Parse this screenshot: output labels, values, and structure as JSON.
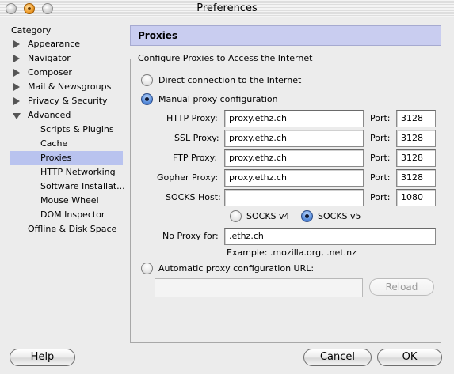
{
  "window": {
    "title": "Preferences"
  },
  "sidebar": {
    "header": "Category",
    "items": [
      {
        "label": "Appearance",
        "expander": "right"
      },
      {
        "label": "Navigator",
        "expander": "right"
      },
      {
        "label": "Composer",
        "expander": "right"
      },
      {
        "label": "Mail & Newsgroups",
        "expander": "right"
      },
      {
        "label": "Privacy & Security",
        "expander": "right"
      },
      {
        "label": "Advanced",
        "expander": "down"
      },
      {
        "label": "Scripts & Plugins"
      },
      {
        "label": "Cache"
      },
      {
        "label": "Proxies",
        "selected": true
      },
      {
        "label": "HTTP Networking"
      },
      {
        "label": "Software Installat..."
      },
      {
        "label": "Mouse Wheel"
      },
      {
        "label": "DOM Inspector"
      },
      {
        "label": "Offline & Disk Space"
      }
    ]
  },
  "panel": {
    "title": "Proxies",
    "group_label": "Configure Proxies to Access the Internet",
    "direct_label": "Direct connection to the Internet",
    "manual_label": "Manual proxy configuration",
    "selected_mode": "manual",
    "port_label": "Port:",
    "proxies": [
      {
        "label": "HTTP Proxy:",
        "host": "proxy.ethz.ch",
        "port": "3128"
      },
      {
        "label": "SSL Proxy:",
        "host": "proxy.ethz.ch",
        "port": "3128"
      },
      {
        "label": "FTP Proxy:",
        "host": "proxy.ethz.ch",
        "port": "3128"
      },
      {
        "label": "Gopher Proxy:",
        "host": "proxy.ethz.ch",
        "port": "3128"
      },
      {
        "label": "SOCKS Host:",
        "host": "",
        "port": "1080"
      }
    ],
    "socks_v4_label": "SOCKS v4",
    "socks_v5_label": "SOCKS v5",
    "socks_selected": "v5",
    "no_proxy_label": "No Proxy for:",
    "no_proxy_value": ".ethz.ch",
    "example_text": "Example: .mozilla.org, .net.nz",
    "auto_label": "Automatic proxy configuration URL:",
    "auto_url": "",
    "reload_label": "Reload"
  },
  "footer": {
    "help_label": "Help",
    "cancel_label": "Cancel",
    "ok_label": "OK"
  },
  "colors": {
    "selected_row": "#b9c3ef",
    "panel_header": "#c9cdf0",
    "radio_on": "#5b8fdc"
  }
}
